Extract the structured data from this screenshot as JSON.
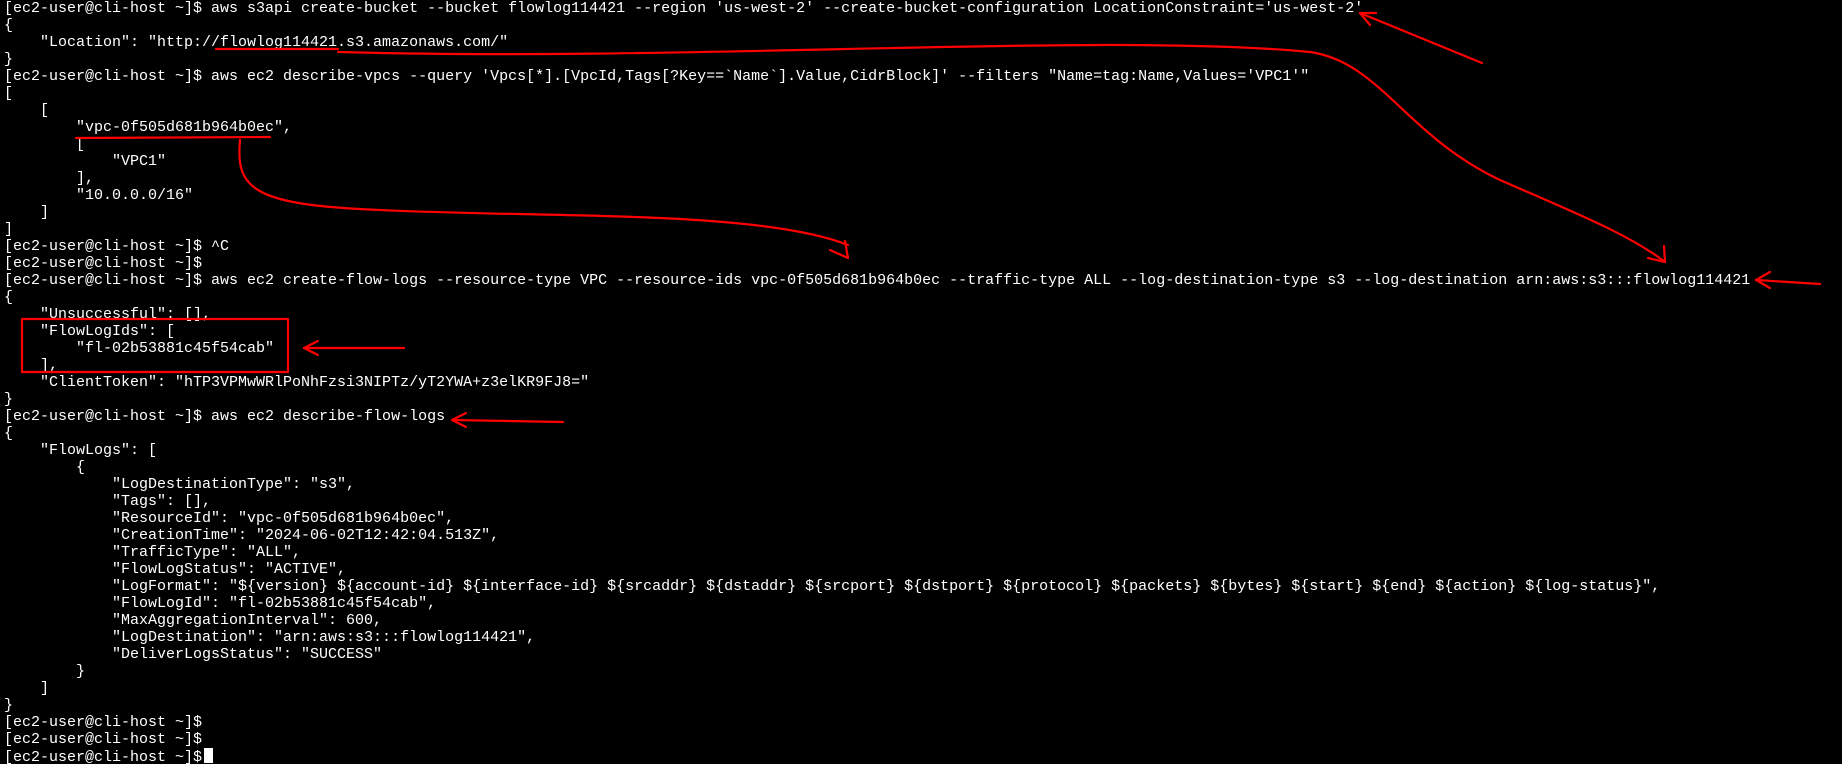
{
  "terminal": {
    "lines": [
      "[ec2-user@cli-host ~]$ aws s3api create-bucket --bucket flowlog114421 --region 'us-west-2' --create-bucket-configuration LocationConstraint='us-west-2'",
      "{",
      "    \"Location\": \"http://flowlog114421.s3.amazonaws.com/\"",
      "}",
      "[ec2-user@cli-host ~]$ aws ec2 describe-vpcs --query 'Vpcs[*].[VpcId,Tags[?Key==`Name`].Value,CidrBlock]' --filters \"Name=tag:Name,Values='VPC1'\"",
      "[",
      "    [",
      "        \"vpc-0f505d681b964b0ec\",",
      "        [",
      "            \"VPC1\"",
      "        ],",
      "        \"10.0.0.0/16\"",
      "    ]",
      "]",
      "[ec2-user@cli-host ~]$ ^C",
      "[ec2-user@cli-host ~]$",
      "[ec2-user@cli-host ~]$ aws ec2 create-flow-logs --resource-type VPC --resource-ids vpc-0f505d681b964b0ec --traffic-type ALL --log-destination-type s3 --log-destination arn:aws:s3:::flowlog114421",
      "{",
      "    \"Unsuccessful\": [],",
      "    \"FlowLogIds\": [",
      "        \"fl-02b53881c45f54cab\"",
      "    ],",
      "    \"ClientToken\": \"hTP3VPMwWRlPoNhFzsi3NIPTz/yT2YWA+z3elKR9FJ8=\"",
      "}",
      "[ec2-user@cli-host ~]$ aws ec2 describe-flow-logs",
      "{",
      "    \"FlowLogs\": [",
      "        {",
      "            \"LogDestinationType\": \"s3\",",
      "            \"Tags\": [],",
      "            \"ResourceId\": \"vpc-0f505d681b964b0ec\",",
      "            \"CreationTime\": \"2024-06-02T12:42:04.513Z\",",
      "            \"TrafficType\": \"ALL\",",
      "            \"FlowLogStatus\": \"ACTIVE\",",
      "            \"LogFormat\": \"${version} ${account-id} ${interface-id} ${srcaddr} ${dstaddr} ${srcport} ${dstport} ${protocol} ${packets} ${bytes} ${start} ${end} ${action} ${log-status}\",",
      "            \"FlowLogId\": \"fl-02b53881c45f54cab\",",
      "            \"MaxAggregationInterval\": 600,",
      "            \"LogDestination\": \"arn:aws:s3:::flowlog114421\",",
      "            \"DeliverLogsStatus\": \"SUCCESS\"",
      "        }",
      "    ]",
      "}",
      "[ec2-user@cli-host ~]$",
      "[ec2-user@cli-host ~]$",
      "[ec2-user@cli-host ~]$"
    ]
  },
  "colors": {
    "background": "#000000",
    "text": "#ffffff",
    "annotation": "#ff0000"
  }
}
